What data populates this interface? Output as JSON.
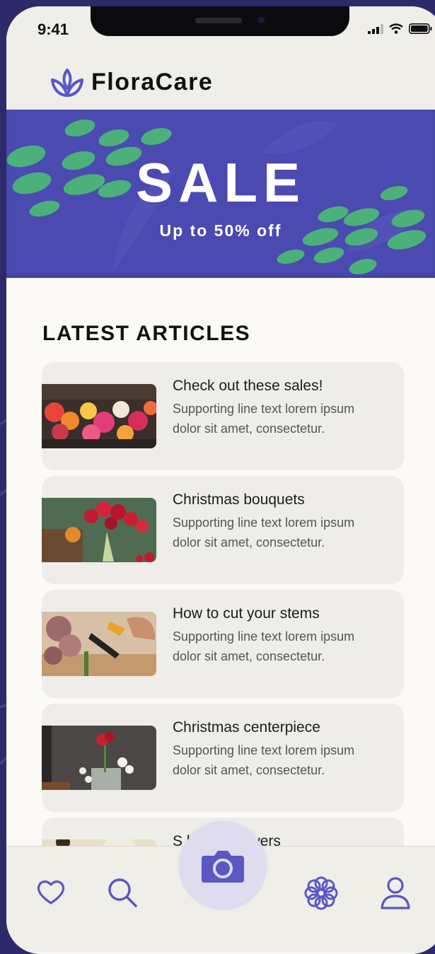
{
  "status_bar": {
    "time": "9:41"
  },
  "header": {
    "brand": "FloraCare"
  },
  "banner": {
    "title": "SALE",
    "subtitle": "Up to 50% off"
  },
  "articles_section": {
    "title": "LATEST ARTICLES",
    "items": [
      {
        "title": "Check out these sales!",
        "description": "Supporting line text lorem ipsum dolor sit amet, consectetur."
      },
      {
        "title": "Christmas bouquets",
        "description": "Supporting line text lorem ipsum dolor sit amet, consectetur."
      },
      {
        "title": "How to cut your stems",
        "description": "Supporting line text lorem ipsum dolor sit amet, consectetur."
      },
      {
        "title": "Christmas centerpiece",
        "description": "Supporting line text lorem ipsum dolor sit amet, consectetur."
      },
      {
        "title": "S lasting flowers",
        "description": ""
      }
    ]
  },
  "bottom_nav": {
    "items": [
      "heart-icon",
      "search-icon",
      "camera-icon",
      "flower-icon",
      "profile-icon"
    ]
  },
  "colors": {
    "accent": "#4b4ab0",
    "accent_light": "#6a66c9",
    "leaf": "#4bb07a",
    "background": "#fbfaf6",
    "card": "#eeede9"
  }
}
